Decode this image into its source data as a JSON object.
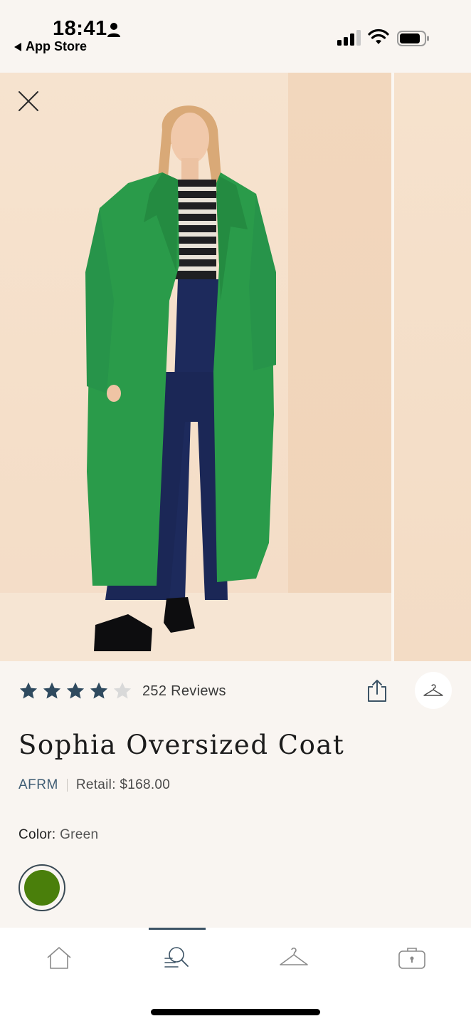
{
  "status_bar": {
    "time": "18:41",
    "back_label": "App Store"
  },
  "product": {
    "rating": 4,
    "rating_max": 5,
    "reviews_label": "252 Reviews",
    "title": "Sophia Oversized Coat",
    "brand": "AFRM",
    "retail": "Retail: $168.00",
    "color_label": "Color:",
    "color_value": "Green",
    "swatch_color": "#4a7f0b"
  },
  "colors": {
    "accent": "#3d5466",
    "star_filled": "#2f4a5f",
    "star_empty": "#d9d9d9",
    "coat": "#2a9b4a"
  },
  "nav": {
    "items": [
      {
        "icon": "home-icon",
        "active": false
      },
      {
        "icon": "search-list-icon",
        "active": true
      },
      {
        "icon": "hanger-icon",
        "active": false
      },
      {
        "icon": "bag-icon",
        "active": false
      }
    ]
  }
}
